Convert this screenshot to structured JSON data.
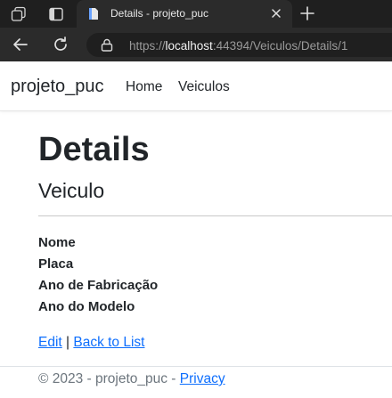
{
  "browser": {
    "tab": {
      "title": "Details - projeto_puc"
    },
    "address": {
      "scheme": "https://",
      "host": "localhost",
      "rest": ":44394/Veiculos/Details/1"
    }
  },
  "site": {
    "brand": "projeto_puc",
    "nav": [
      {
        "label": "Home"
      },
      {
        "label": "Veiculos"
      }
    ]
  },
  "content": {
    "heading": "Details",
    "subheading": "Veiculo",
    "fields": [
      {
        "label": "Nome"
      },
      {
        "label": "Placa"
      },
      {
        "label": "Ano de Fabricação"
      },
      {
        "label": "Ano do Modelo"
      }
    ],
    "actions": {
      "edit": "Edit",
      "separator": " | ",
      "back": "Back to List"
    }
  },
  "footer": {
    "text": "© 2023 - projeto_puc - ",
    "privacy": "Privacy"
  },
  "colors": {
    "link": "#0d6efd",
    "chrome_dark": "#1f1f1f",
    "chrome_toolbar": "#2b2b2b",
    "text": "#212529",
    "muted": "#6c757d"
  }
}
